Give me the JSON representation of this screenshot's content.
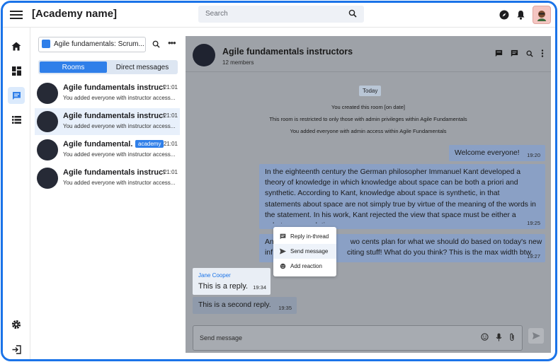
{
  "app": {
    "title": "[Academy name]"
  },
  "search": {
    "placeholder": "Search"
  },
  "room_select": {
    "label": "Agile fundamentals: Scrum..."
  },
  "tabs": {
    "rooms": "Rooms",
    "direct": "Direct messages"
  },
  "rooms": [
    {
      "name": "Agile fundamentals instruct...",
      "time": "21:01",
      "preview": "You added everyone with instructor access..."
    },
    {
      "name": "Agile fundamentals instruct...",
      "time": "21:01",
      "preview": "You added everyone with instructor access..."
    },
    {
      "name": "Agile fundamental...",
      "time": "21:01",
      "badge": "academy",
      "preview": "You added everyone with instructor access..."
    },
    {
      "name": "Agile fundamentals instruct...",
      "time": "21:01",
      "preview": "You added everyone with instructor access..."
    }
  ],
  "chat": {
    "title": "Agile fundamentals instructors",
    "members": "12 members",
    "date_chip": "Today",
    "system_messages": [
      "You created this room [on date]",
      "This room is restricted to only those with admin privileges within Agile Fundamentals",
      "You added everyone with admin access within Agile Fundamentals"
    ],
    "messages": [
      {
        "text": "Welcome everyone!",
        "time": "19:20"
      },
      {
        "text": "In the eighteenth century the German philosopher Immanuel Kant developed a theory of knowledge in which knowledge about space can be both a priori and synthetic. According to Kant, knowledge about space is synthetic, in that statements about space are not simply true by virtue of the meaning of the words in the statement. In his work, Kant rejected the view that space must be either a substance or relation.",
        "time": "19:25"
      },
      {
        "text_line1": "An",
        "text_line1b": "wo cents plan for what we should do based on today's new",
        "text_line2": "inf",
        "text_line2b": "citing stuff! What do you think? This is the max width btw.",
        "time": "19:27"
      }
    ],
    "reply": {
      "author": "Jane Cooper",
      "text": "This is a reply.",
      "time": "19:34"
    },
    "reply2": {
      "text": "This is a second reply.",
      "time": "19:35"
    },
    "context_menu": [
      "Reply in-thread",
      "Send message",
      "Add reaction"
    ],
    "composer_placeholder": "Send message"
  },
  "colors": {
    "accent": "#2f7fe9",
    "frame": "#1a73e8"
  }
}
